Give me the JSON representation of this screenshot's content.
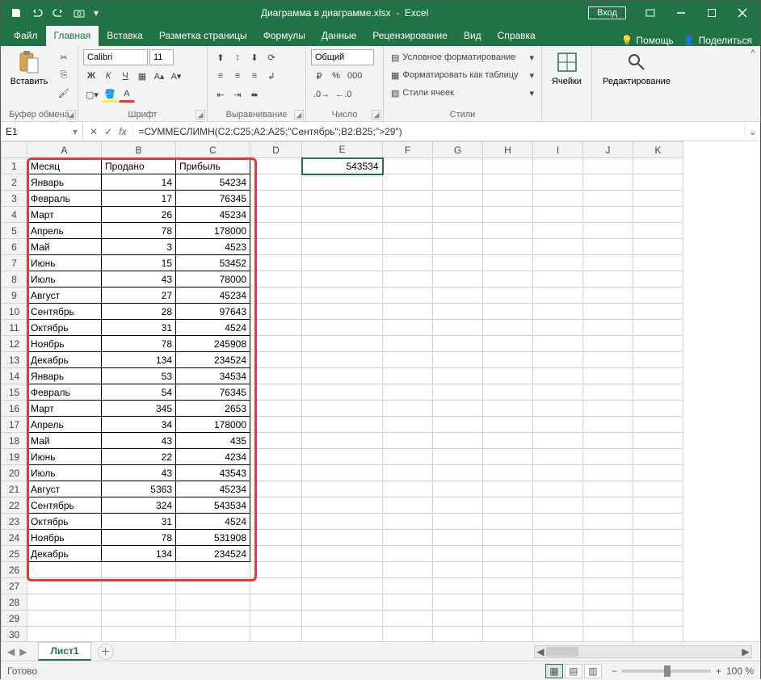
{
  "titlebar": {
    "filename": "Диаграмма в диаграмме.xlsx",
    "appname": "Excel",
    "signin": "Вход"
  },
  "tabs": {
    "file": "Файл",
    "home": "Главная",
    "insert": "Вставка",
    "pagelayout": "Разметка страницы",
    "formulas": "Формулы",
    "data": "Данные",
    "review": "Рецензирование",
    "view": "Вид",
    "help": "Справка",
    "tellme": "Помощь",
    "share": "Поделиться"
  },
  "ribbon": {
    "clipboard": {
      "label": "Буфер обмена",
      "paste": "Вставить"
    },
    "font": {
      "label": "Шрифт",
      "family": "Calibri",
      "size": "11",
      "bold": "Ж",
      "italic": "К",
      "underline": "Ч"
    },
    "alignment": {
      "label": "Выравнивание"
    },
    "number": {
      "label": "Число",
      "format": "Общий"
    },
    "styles": {
      "label": "Стили",
      "cond": "Условное форматирование",
      "table": "Форматировать как таблицу",
      "cell": "Стили ячеек"
    },
    "cells": {
      "label": "Ячейки"
    },
    "editing": {
      "label": "Редактирование"
    }
  },
  "namebox": "E1",
  "formula": "=СУММЕСЛИМН(C2:C25;A2:A25;\"Сентябрь\";B2:B25;\">29\")",
  "columns": [
    "A",
    "B",
    "C",
    "D",
    "E",
    "F",
    "G",
    "H",
    "I",
    "J",
    "K"
  ],
  "headers": {
    "a": "Месяц",
    "b": "Продано",
    "c": "Прибыль"
  },
  "result_e1": "543534",
  "rows": [
    {
      "a": "Январь",
      "b": "14",
      "c": "54234"
    },
    {
      "a": "Февраль",
      "b": "17",
      "c": "76345"
    },
    {
      "a": "Март",
      "b": "26",
      "c": "45234"
    },
    {
      "a": "Апрель",
      "b": "78",
      "c": "178000"
    },
    {
      "a": "Май",
      "b": "3",
      "c": "4523"
    },
    {
      "a": "Июнь",
      "b": "15",
      "c": "53452"
    },
    {
      "a": "Июль",
      "b": "43",
      "c": "78000"
    },
    {
      "a": "Август",
      "b": "27",
      "c": "45234"
    },
    {
      "a": "Сентябрь",
      "b": "28",
      "c": "97643"
    },
    {
      "a": "Октябрь",
      "b": "31",
      "c": "4524"
    },
    {
      "a": "Ноябрь",
      "b": "78",
      "c": "245908"
    },
    {
      "a": "Декабрь",
      "b": "134",
      "c": "234524"
    },
    {
      "a": "Январь",
      "b": "53",
      "c": "34534"
    },
    {
      "a": "Февраль",
      "b": "54",
      "c": "76345"
    },
    {
      "a": "Март",
      "b": "345",
      "c": "2653"
    },
    {
      "a": "Апрель",
      "b": "34",
      "c": "178000"
    },
    {
      "a": "Май",
      "b": "43",
      "c": "435"
    },
    {
      "a": "Июнь",
      "b": "22",
      "c": "4234"
    },
    {
      "a": "Июль",
      "b": "43",
      "c": "43543"
    },
    {
      "a": "Август",
      "b": "5363",
      "c": "45234"
    },
    {
      "a": "Сентябрь",
      "b": "324",
      "c": "543534"
    },
    {
      "a": "Октябрь",
      "b": "31",
      "c": "4524"
    },
    {
      "a": "Ноябрь",
      "b": "78",
      "c": "531908"
    },
    {
      "a": "Декабрь",
      "b": "134",
      "c": "234524"
    }
  ],
  "sheet": {
    "name": "Лист1"
  },
  "status": {
    "ready": "Готово",
    "zoom": "100 %"
  }
}
